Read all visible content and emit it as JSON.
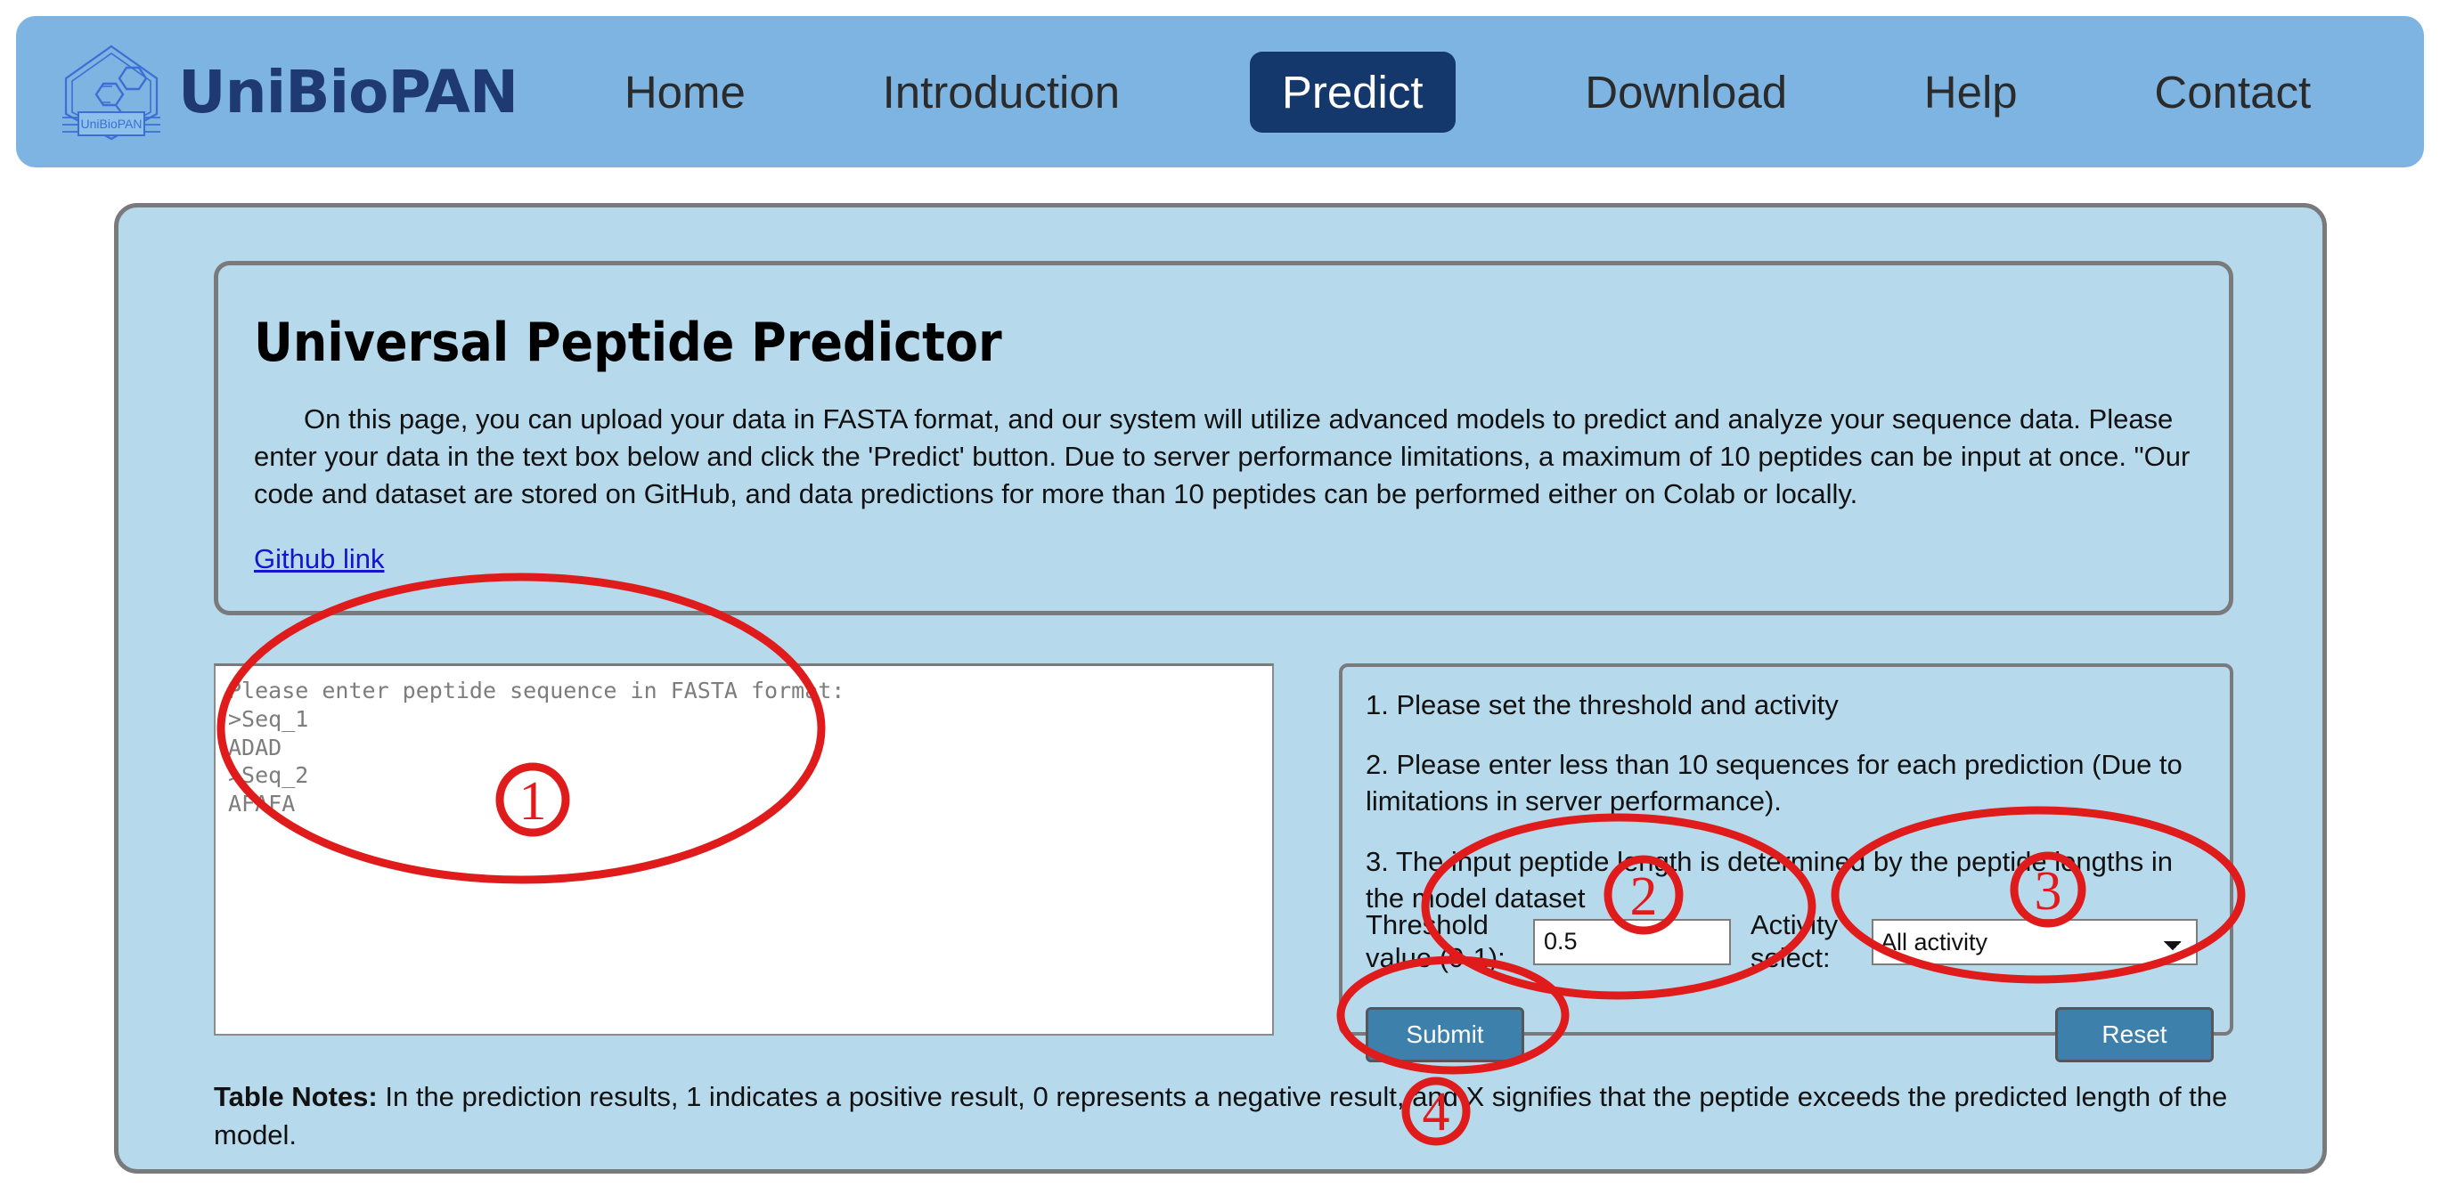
{
  "nav": {
    "brand": "UniBioPAN",
    "logo_label": "UniBioPAN",
    "active_index": 2,
    "links": [
      {
        "label": "Home"
      },
      {
        "label": "Introduction"
      },
      {
        "label": "Predict"
      },
      {
        "label": "Download"
      },
      {
        "label": "Help"
      },
      {
        "label": "Contact"
      }
    ],
    "colors": {
      "bar": "#7eb4e2",
      "active_bg": "#14386b",
      "brand": "#1f3a73"
    }
  },
  "intro": {
    "title": "Universal Peptide Predictor",
    "paragraph": "On this page, you can upload your data in FASTA format, and our system will utilize advanced models to predict and analyze your sequence data. Please enter your data in the text box below and click the 'Predict' button. Due to server performance limitations, a maximum of 10 peptides can be input at once. \"Our code and dataset are stored on GitHub, and data predictions for more than 10 peptides can be performed either on Colab or locally.",
    "link_label": "Github link"
  },
  "input": {
    "textarea_placeholder": "Please enter peptide sequence in FASTA format:\n>Seq_1\nADAD\n>Seq_2\nAFAFA",
    "textarea_value": ""
  },
  "options": {
    "notes": [
      "1. Please set the threshold and activity",
      "2. Please enter less than 10 sequences for each prediction (Due to limitations in server performance).",
      "3. The input peptide length is determined by the peptide lengths in the model dataset"
    ],
    "threshold_label": "Threshold value (0-1):",
    "threshold_value": "0.5",
    "activity_label": "Activity select:",
    "activity_selected": "All activity",
    "activity_options": [
      "All activity"
    ],
    "submit_label": "Submit",
    "reset_label": "Reset",
    "button_color": "#3c80ab"
  },
  "footer": {
    "notes_prefix": "Table Notes:",
    "notes_text": " In the prediction results, 1 indicates a positive result, 0 represents a negative result, and X signifies that the peptide exceeds the predicted length of the model."
  },
  "annotations": {
    "color": "#e01b1b",
    "markers": [
      {
        "id": "1",
        "label": "1"
      },
      {
        "id": "2",
        "label": "2"
      },
      {
        "id": "3",
        "label": "3"
      },
      {
        "id": "4",
        "label": "4"
      }
    ]
  }
}
